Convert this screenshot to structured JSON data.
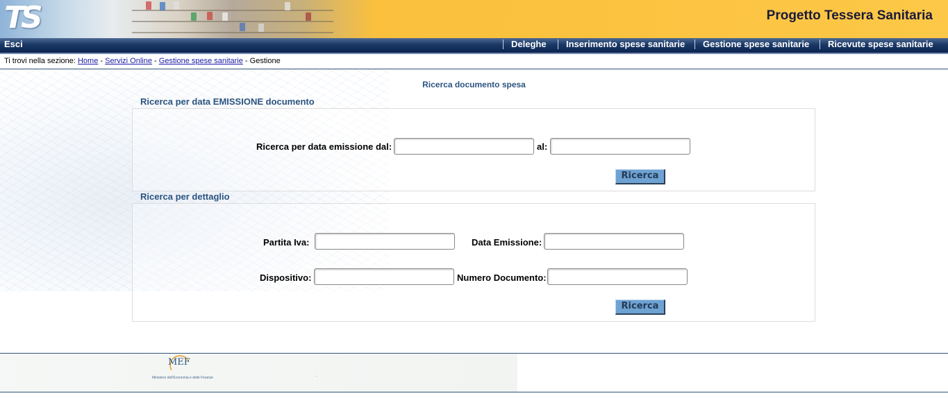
{
  "header": {
    "logo_text": "TS",
    "title": "Progetto Tessera Sanitaria"
  },
  "nav": {
    "left_link": "Esci",
    "items": [
      {
        "label": "Deleghe"
      },
      {
        "label": "Inserimento spese sanitarie"
      },
      {
        "label": "Gestione spese sanitarie"
      },
      {
        "label": "Ricevute spese sanitarie"
      }
    ]
  },
  "breadcrumb": {
    "prefix": "Ti trovi nella sezione:",
    "links": [
      "Home",
      "Servizi Online",
      "Gestione spese sanitarie"
    ],
    "separator": "-",
    "current": "Gestione"
  },
  "main": {
    "title": "Ricerca documento spesa",
    "section_date": {
      "title": "Ricerca per data EMISSIONE documento",
      "from_label": "Ricerca per data emissione dal:",
      "from_value": "",
      "to_label": "al:",
      "to_value": "",
      "button_label": "Ricerca"
    },
    "section_detail": {
      "title": "Ricerca per dettaglio",
      "partita_iva_label": "Partita Iva:",
      "partita_iva_value": "",
      "data_emissione_label": "Data Emissione:",
      "data_emissione_value": "",
      "dispositivo_label": "Dispositivo:",
      "dispositivo_value": "",
      "numero_documento_label": "Numero Documento:",
      "numero_documento_value": "",
      "button_label": "Ricerca"
    }
  },
  "footer": {
    "logo_text": "MEF",
    "logo_caption": "Ministero dell'Economia e delle Finanze",
    "dot": "."
  },
  "colors": {
    "banner": "#fbc23f",
    "nav_bg": "#0c2450",
    "heading": "#2b5480",
    "button": "#6ea2d2"
  }
}
